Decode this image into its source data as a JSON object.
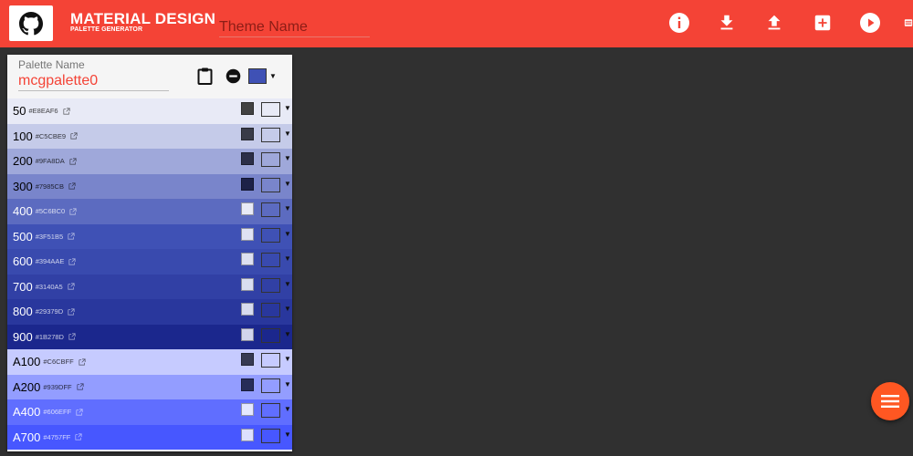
{
  "header": {
    "title": "MATERIAL DESIGN",
    "subtitle": "PALETTE GENERATOR",
    "theme_placeholder": "Theme Name",
    "accent_color": "#f44336",
    "github_icon": "github-icon",
    "actions": [
      {
        "name": "info-icon"
      },
      {
        "name": "download-icon"
      },
      {
        "name": "upload-icon"
      },
      {
        "name": "add-palette-icon"
      },
      {
        "name": "play-icon"
      },
      {
        "name": "more-icon"
      }
    ]
  },
  "palette": {
    "label": "Palette Name",
    "name": "mcgpalette0",
    "base_color": "#3f51b5",
    "icons": [
      "clipboard-icon",
      "remove-icon",
      "base-color-swatch"
    ],
    "rows": [
      {
        "shade": "50",
        "hex": "#E8EAF6",
        "bg": "#e8eaf6",
        "text": "#000000",
        "swatch_a": "#424242",
        "swatch_b": "#e8eaf6"
      },
      {
        "shade": "100",
        "hex": "#C5CBE9",
        "bg": "#c5cbe9",
        "text": "#000000",
        "swatch_a": "#393b48",
        "swatch_b": "#c5cbe9"
      },
      {
        "shade": "200",
        "hex": "#9FA8DA",
        "bg": "#9fa8da",
        "text": "#000000",
        "swatch_a": "#2c2f48",
        "swatch_b": "#9fa8da"
      },
      {
        "shade": "300",
        "hex": "#7985CB",
        "bg": "#7985cb",
        "text": "#000000",
        "swatch_a": "#1d2148",
        "swatch_b": "#7985cb"
      },
      {
        "shade": "400",
        "hex": "#5C6BC0",
        "bg": "#5c6bc0",
        "text": "#ffffff",
        "swatch_a": "#e8eaf6",
        "swatch_b": "#5c6bc0"
      },
      {
        "shade": "500",
        "hex": "#3F51B5",
        "bg": "#3f51b5",
        "text": "#ffffff",
        "swatch_a": "#dfe2f3",
        "swatch_b": "#3f51b5"
      },
      {
        "shade": "600",
        "hex": "#394AAE",
        "bg": "#394aae",
        "text": "#ffffff",
        "swatch_a": "#dde0f1",
        "swatch_b": "#394aae"
      },
      {
        "shade": "700",
        "hex": "#3140A5",
        "bg": "#3140a5",
        "text": "#ffffff",
        "swatch_a": "#dadef0",
        "swatch_b": "#3140a5"
      },
      {
        "shade": "800",
        "hex": "#29379D",
        "bg": "#29379d",
        "text": "#ffffff",
        "swatch_a": "#d7dbef",
        "swatch_b": "#29379d"
      },
      {
        "shade": "900",
        "hex": "#1B278D",
        "bg": "#1b278d",
        "text": "#ffffff",
        "swatch_a": "#d2d5ec",
        "swatch_b": "#1b278d"
      },
      {
        "shade": "A100",
        "hex": "#C6CBFF",
        "bg": "#c6cbff",
        "text": "#000000",
        "swatch_a": "#373a52",
        "swatch_b": "#c6cbff"
      },
      {
        "shade": "A200",
        "hex": "#939DFF",
        "bg": "#939dff",
        "text": "#000000",
        "swatch_a": "#272c58",
        "swatch_b": "#939dff"
      },
      {
        "shade": "A400",
        "hex": "#606EFF",
        "bg": "#606eff",
        "text": "#ffffff",
        "swatch_a": "#e4e7ff",
        "swatch_b": "#606eff"
      },
      {
        "shade": "A700",
        "hex": "#4757FF",
        "bg": "#4757ff",
        "text": "#ffffff",
        "swatch_a": "#dde0ff",
        "swatch_b": "#4757ff"
      }
    ]
  },
  "fab": {
    "icon": "menu-icon",
    "color": "#ff5722"
  },
  "background": "#303030"
}
